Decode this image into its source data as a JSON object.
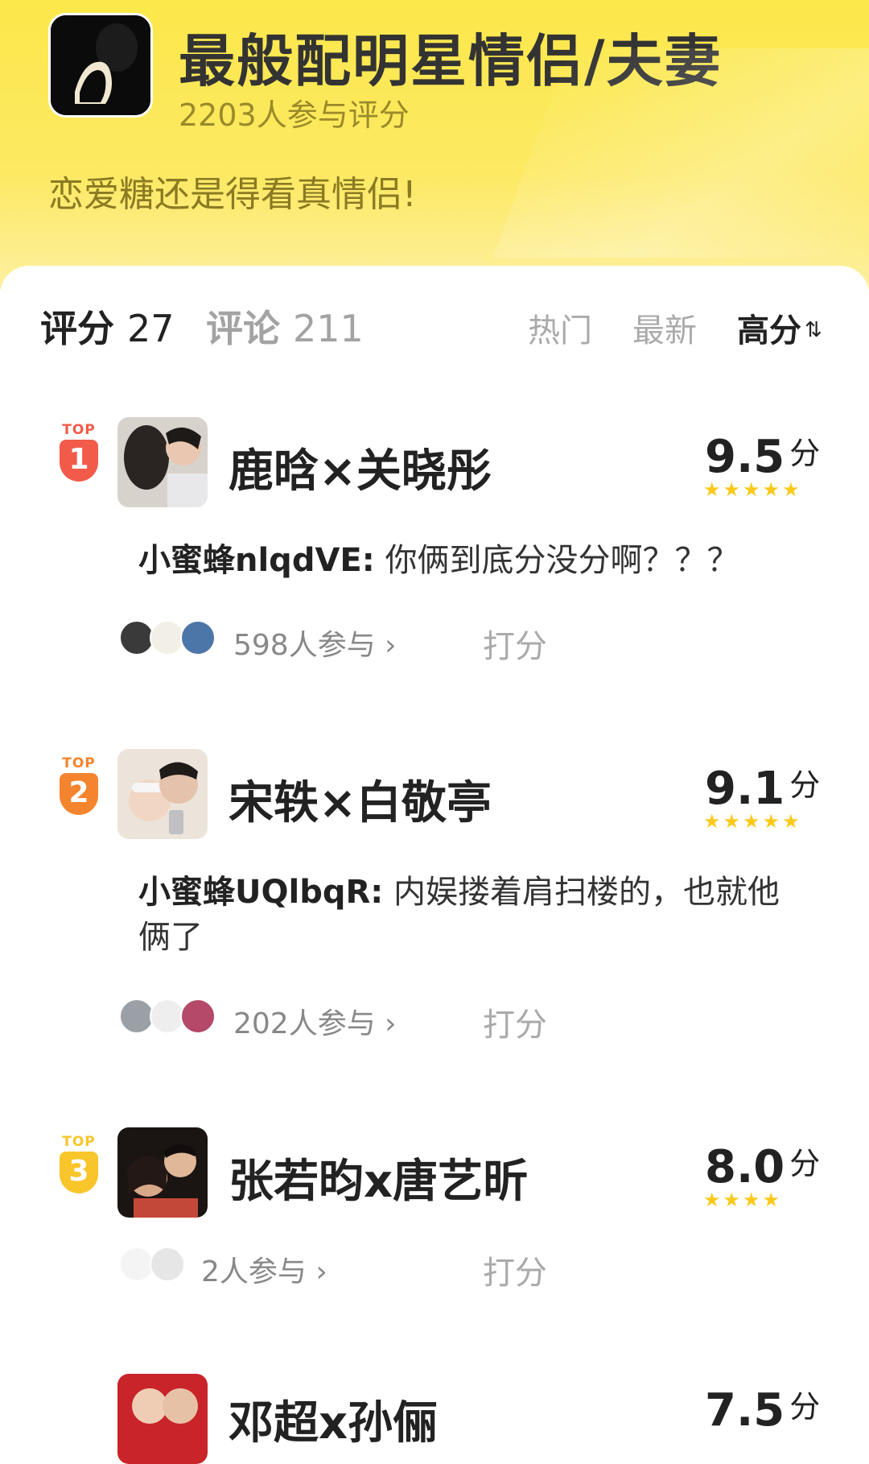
{
  "header": {
    "title": "最般配明星情侣/夫妻",
    "participants": "2203人参与评分",
    "slogan": "恋爱糖还是得看真情侣!"
  },
  "tabs": {
    "score_label": "评分",
    "score_count": "27",
    "comment_label": "评论",
    "comment_count": "211"
  },
  "sort": {
    "hot": "热门",
    "new": "最新",
    "high": "高分",
    "high_icon": "⇅"
  },
  "entries": [
    {
      "rank_label": "TOP",
      "rank": "1",
      "name": "鹿晗×关晓彤",
      "score": "9.5",
      "unit": "分",
      "stars": "★★★★★",
      "comment_user": "小蜜蜂nlqdVE:",
      "comment_text": "你俩到底分没分啊？？？",
      "joined": "598人参与 ›",
      "rate_label": "打分",
      "badge_color": "#f25b4a"
    },
    {
      "rank_label": "TOP",
      "rank": "2",
      "name": "宋轶×白敬亭",
      "score": "9.1",
      "unit": "分",
      "stars": "★★★★★",
      "comment_user": "小蜜蜂UQlbqR:",
      "comment_text": "内娱搂着肩扫楼的，也就他俩了",
      "joined": "202人参与 ›",
      "rate_label": "打分",
      "badge_color": "#f5842f"
    },
    {
      "rank_label": "TOP",
      "rank": "3",
      "name": "张若昀x唐艺昕",
      "score": "8.0",
      "unit": "分",
      "stars": "★★★★",
      "joined": "2人参与 ›",
      "rate_label": "打分",
      "badge_color": "#f8c52a"
    },
    {
      "name": "邓超x孙俪",
      "score": "7.5",
      "unit": "分"
    }
  ]
}
